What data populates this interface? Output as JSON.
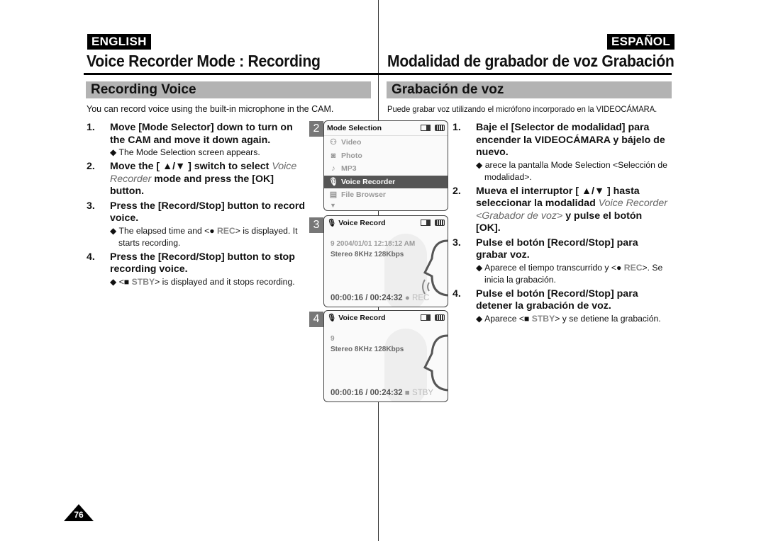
{
  "page_number": "76",
  "english": {
    "lang_label": "ENGLISH",
    "title": "Voice Recorder Mode : Recording",
    "section": "Recording Voice",
    "intro": "You can record voice using the built-in microphone in the CAM.",
    "steps": [
      {
        "num": "1.",
        "text": "Move [Mode Selector] down to turn on the CAM and move it down again.",
        "note": "◆ The Mode Selection screen appears."
      },
      {
        "num": "2.",
        "text_a": "Move the [ ▲/▼ ] switch to select ",
        "text_it": "Voice Recorder",
        "text_b": " mode and press the [OK] button."
      },
      {
        "num": "3.",
        "text": "Press the [Record/Stop] button to record voice.",
        "note_a": "◆ The elapsed time and <● ",
        "note_hl": "REC",
        "note_b": "> is displayed. It starts recording."
      },
      {
        "num": "4.",
        "text": "Press the [Record/Stop] button to stop recording voice.",
        "note_a": "◆ <■ ",
        "note_hl": "STBY",
        "note_b": "> is displayed and it stops recording."
      }
    ]
  },
  "spanish": {
    "lang_label": "ESPAÑOL",
    "title": "Modalidad de grabador de voz Grabación",
    "section": "Grabación de voz",
    "intro": "Puede grabar voz utilizando el micrófono incorporado en la VIDEOCÁMARA.",
    "steps": [
      {
        "num": "1.",
        "text": "Baje el [Selector de modalidad] para encender la VIDEOCÁMARA y bájelo de nuevo.",
        "note": "◆ arece la pantalla Mode Selection <Selección de modalidad>."
      },
      {
        "num": "2.",
        "text_a": "Mueva el interruptor [ ▲/▼ ] hasta seleccionar la modalidad ",
        "text_it": "Voice Recorder <Grabador de voz>",
        "text_b": " y pulse el botón [OK]."
      },
      {
        "num": "3.",
        "text": "Pulse el botón [Record/Stop] para grabar voz.",
        "note_a": "◆ Aparece el tiempo transcurrido y <● ",
        "note_hl": "REC",
        "note_b": ">. Se inicia la grabación."
      },
      {
        "num": "4.",
        "text": "Pulse el botón [Record/Stop] para detener la grabación de voz.",
        "note_a": "◆ Aparece <■ ",
        "note_hl": "STBY",
        "note_b": "> y se detiene la grabación."
      }
    ]
  },
  "screens": {
    "mode_selection": {
      "num": "2",
      "title": "Mode Selection",
      "items": [
        {
          "icon": "video-camera-icon",
          "label": "Video"
        },
        {
          "icon": "camera-icon",
          "label": "Photo"
        },
        {
          "icon": "music-note-icon",
          "label": "MP3"
        },
        {
          "icon": "microphone-icon",
          "label": "Voice Recorder",
          "selected": true
        },
        {
          "icon": "document-icon",
          "label": "File Browser"
        }
      ]
    },
    "recording": {
      "num": "3",
      "title": "Voice Record",
      "file_info": "9  2004/01/01 12:18:12 AM",
      "format": "Stereo  8KHz  128Kbps",
      "elapsed": "00:00:16",
      "total": "00:24:32",
      "status": "REC"
    },
    "standby": {
      "num": "4",
      "title": "Voice Record",
      "file_info": "9",
      "format": "Stereo  8KHz  128Kbps",
      "elapsed": "00:00:16",
      "total": "00:24:32",
      "status": "STBY"
    }
  }
}
